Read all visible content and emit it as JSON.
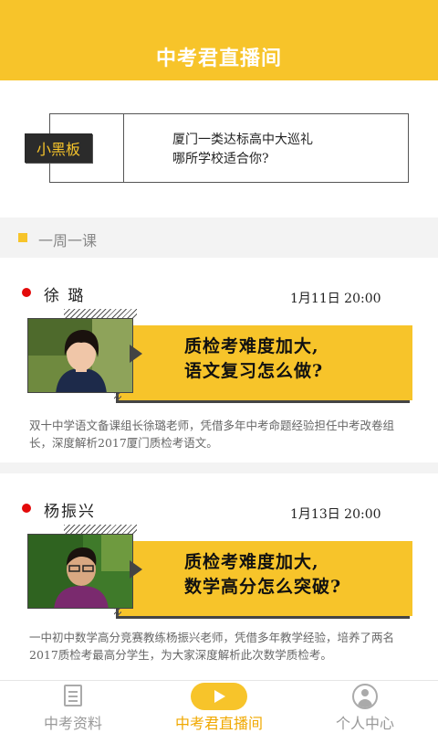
{
  "header": {
    "title": "中考君直播间"
  },
  "blackboard": {
    "tag": "小黑板",
    "line1": "厦门一类达标高中大巡礼",
    "line2": "哪所学校适合你?"
  },
  "section": {
    "title": "一周一课"
  },
  "lessons": [
    {
      "teacher": "徐  璐",
      "time": "1月11日 20:00",
      "headline1": "质检考难度加大,",
      "headline2": "语文复习怎么做?",
      "description": "双十中学语文备课组长徐璐老师，凭借多年中考命题经验担任中考改卷组长，深度解析2017厦门质检考语文。"
    },
    {
      "teacher": "杨振兴",
      "time": "1月13日 20:00",
      "headline1": "质检考难度加大,",
      "headline2": "数学高分怎么突破?",
      "description": "一中初中数学高分竞赛教练杨振兴老师，凭借多年教学经验，培养了两名2017质检考最高分学生，为大家深度解析此次数学质检考。"
    }
  ],
  "tabbar": {
    "items": [
      {
        "label": "中考资料",
        "icon": "document-icon"
      },
      {
        "label": "中考君直播间",
        "icon": "play-icon"
      },
      {
        "label": "个人中心",
        "icon": "user-icon"
      }
    ],
    "active_index": 1
  },
  "colors": {
    "accent": "#f7c42a",
    "dot": "#e30a0a",
    "active_tab": "#f0a800"
  }
}
